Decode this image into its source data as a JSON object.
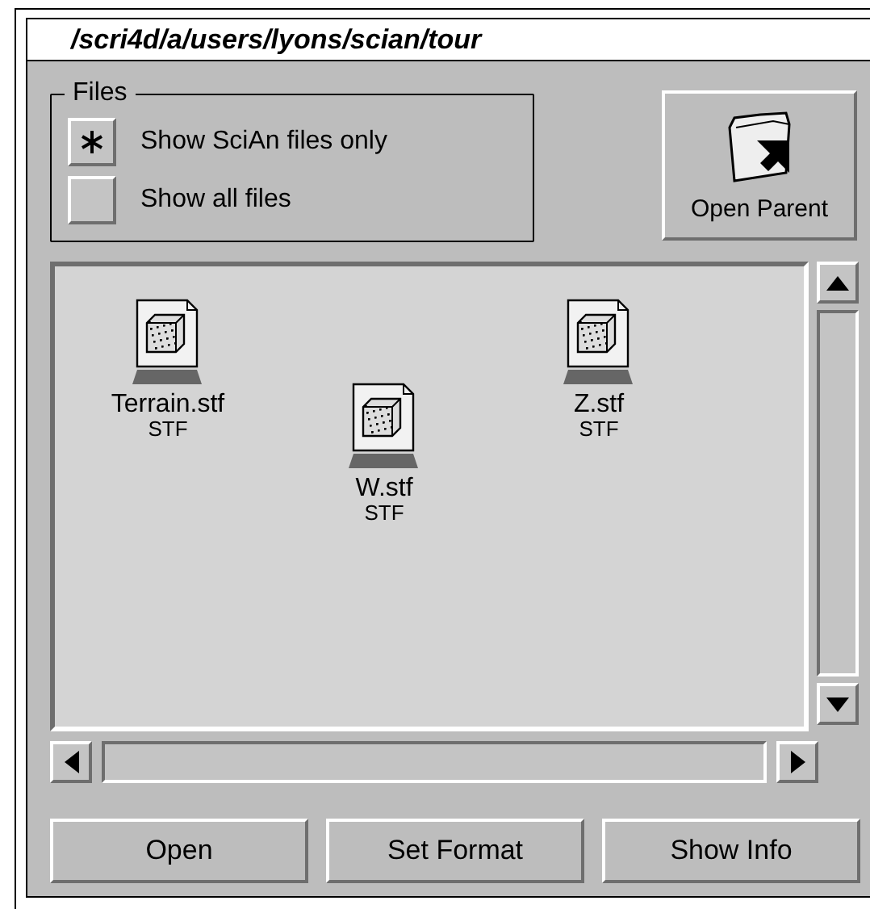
{
  "window": {
    "title": "/scri4d/a/users/lyons/scian/tour"
  },
  "files_group": {
    "label": "Files",
    "options": [
      {
        "label": "Show SciAn files only",
        "selected": true
      },
      {
        "label": "Show all files",
        "selected": false
      }
    ]
  },
  "open_parent_button": {
    "label": "Open Parent"
  },
  "file_list": [
    {
      "name": "Terrain.stf",
      "type": "STF"
    },
    {
      "name": "W.stf",
      "type": "STF"
    },
    {
      "name": "Z.stf",
      "type": "STF"
    }
  ],
  "buttons": [
    "Open",
    "Set Format",
    "Show Info"
  ]
}
